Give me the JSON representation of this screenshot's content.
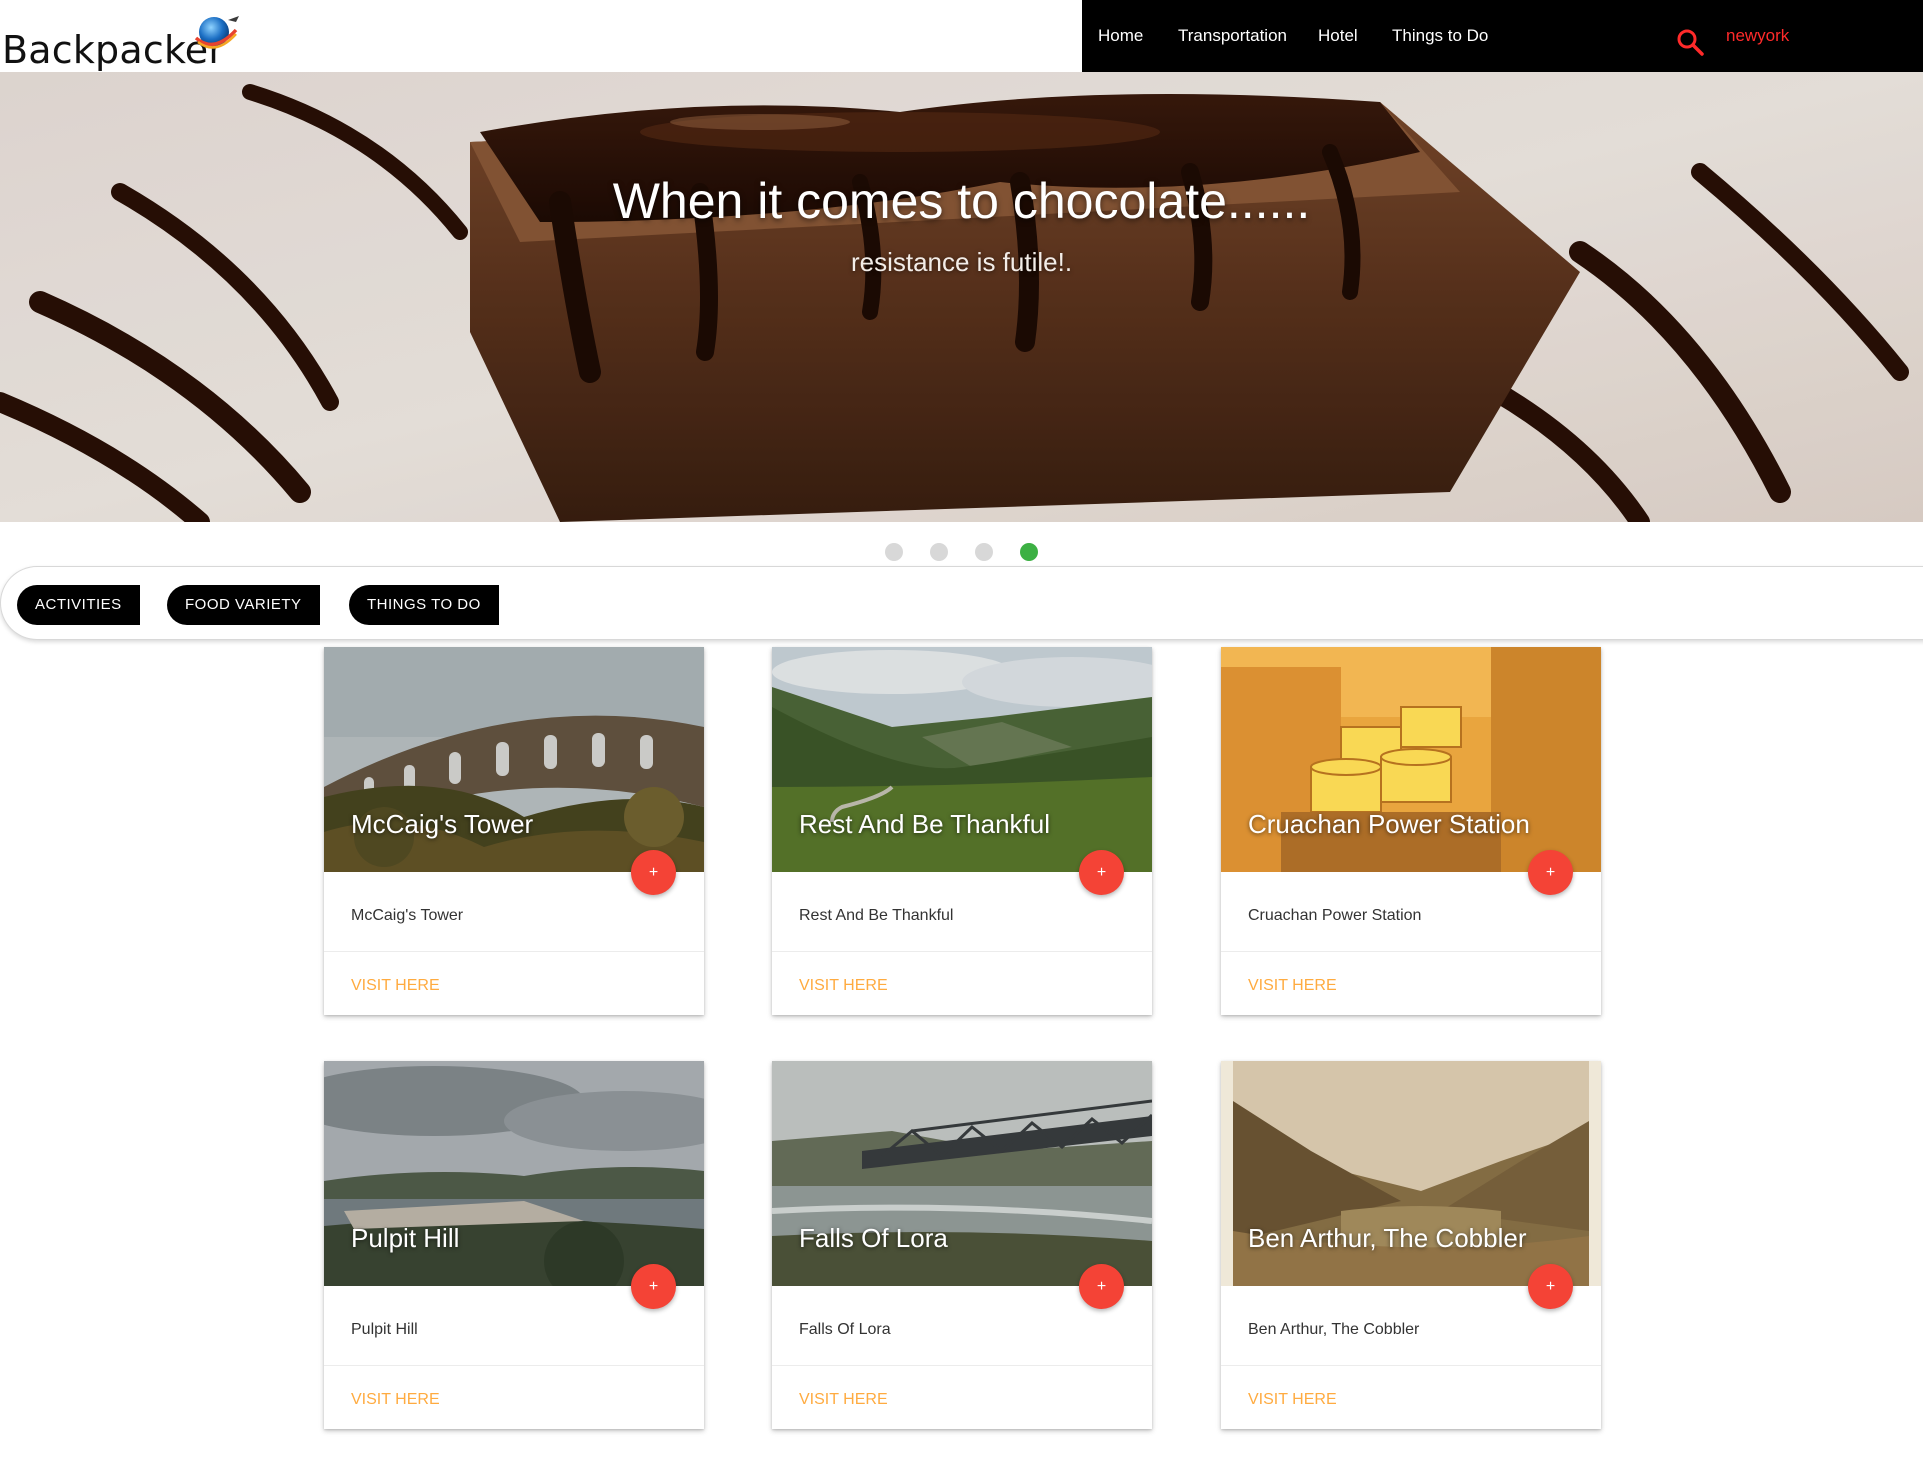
{
  "header": {
    "brand": "Backpacker",
    "logo_icon": "globe-plane-icon",
    "nav": [
      "Home",
      "Transportation",
      "Hotel",
      "Things to Do"
    ],
    "search_icon": "search-icon",
    "search_value": "newyork"
  },
  "hero": {
    "title": "When it comes to chocolate......",
    "subtitle": "resistance is futile!.",
    "slides": 4,
    "active_slide": 4
  },
  "tabs": [
    "ACTIVITIES",
    "FOOD VARIETY",
    "THINGS TO DO"
  ],
  "cards": [
    {
      "title": "McCaig's Tower",
      "content": "McCaig's Tower",
      "action": "VISIT HERE",
      "fab": "+"
    },
    {
      "title": "Rest And Be Thankful",
      "content": "Rest And Be Thankful",
      "action": "VISIT HERE",
      "fab": "+"
    },
    {
      "title": "Cruachan Power Station",
      "content": "Cruachan Power Station",
      "action": "VISIT HERE",
      "fab": "+"
    },
    {
      "title": "Pulpit Hill",
      "content": "Pulpit Hill",
      "action": "VISIT HERE",
      "fab": "+"
    },
    {
      "title": "Falls Of Lora",
      "content": "Falls Of Lora",
      "action": "VISIT HERE",
      "fab": "+"
    },
    {
      "title": "Ben Arthur, The Cobbler",
      "content": "Ben Arthur, The Cobbler",
      "action": "VISIT HERE",
      "fab": "+"
    }
  ],
  "colors": {
    "navbar": "#000000",
    "search_accent": "#ff2a2a",
    "active_dot": "#3cb043",
    "fab": "#f44336",
    "action_link": "#ffab40"
  }
}
